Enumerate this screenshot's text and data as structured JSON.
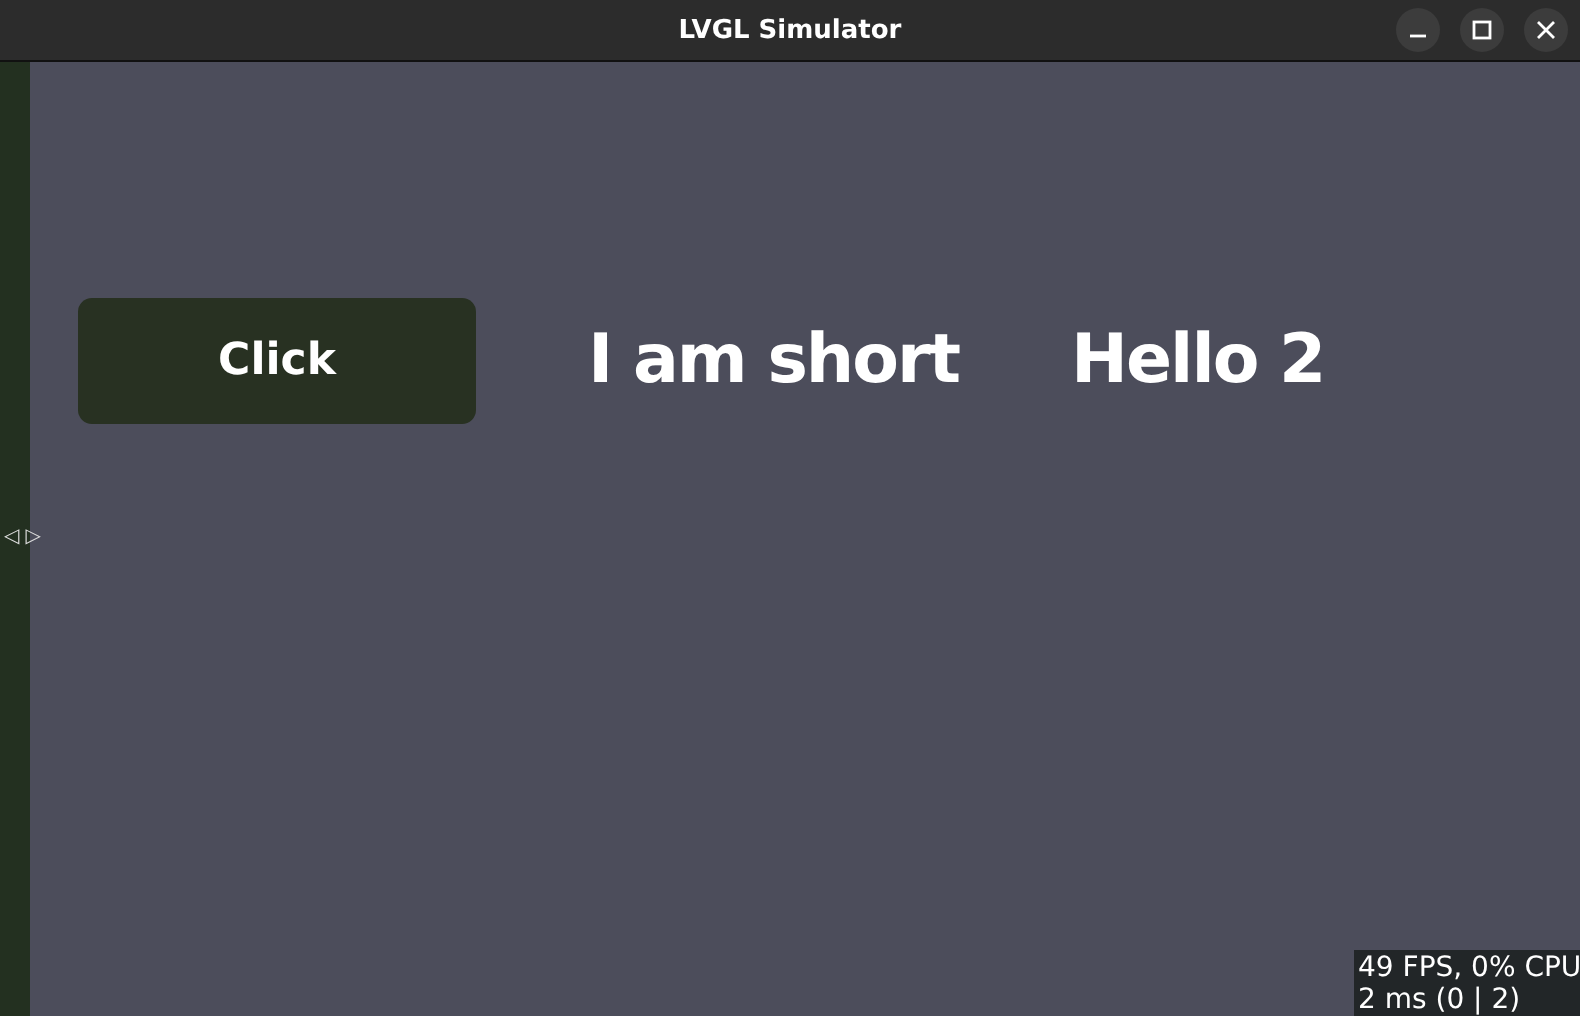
{
  "window": {
    "title": "LVGL Simulator"
  },
  "content": {
    "button": {
      "label": "Click"
    },
    "labels": [
      "I am short",
      "Hello 2"
    ]
  },
  "side_handle": {
    "left": "◁",
    "right": "▷"
  },
  "perf_monitor": {
    "lines": [
      "49 FPS, 0% CPU",
      "2 ms (0 | 2)"
    ]
  }
}
